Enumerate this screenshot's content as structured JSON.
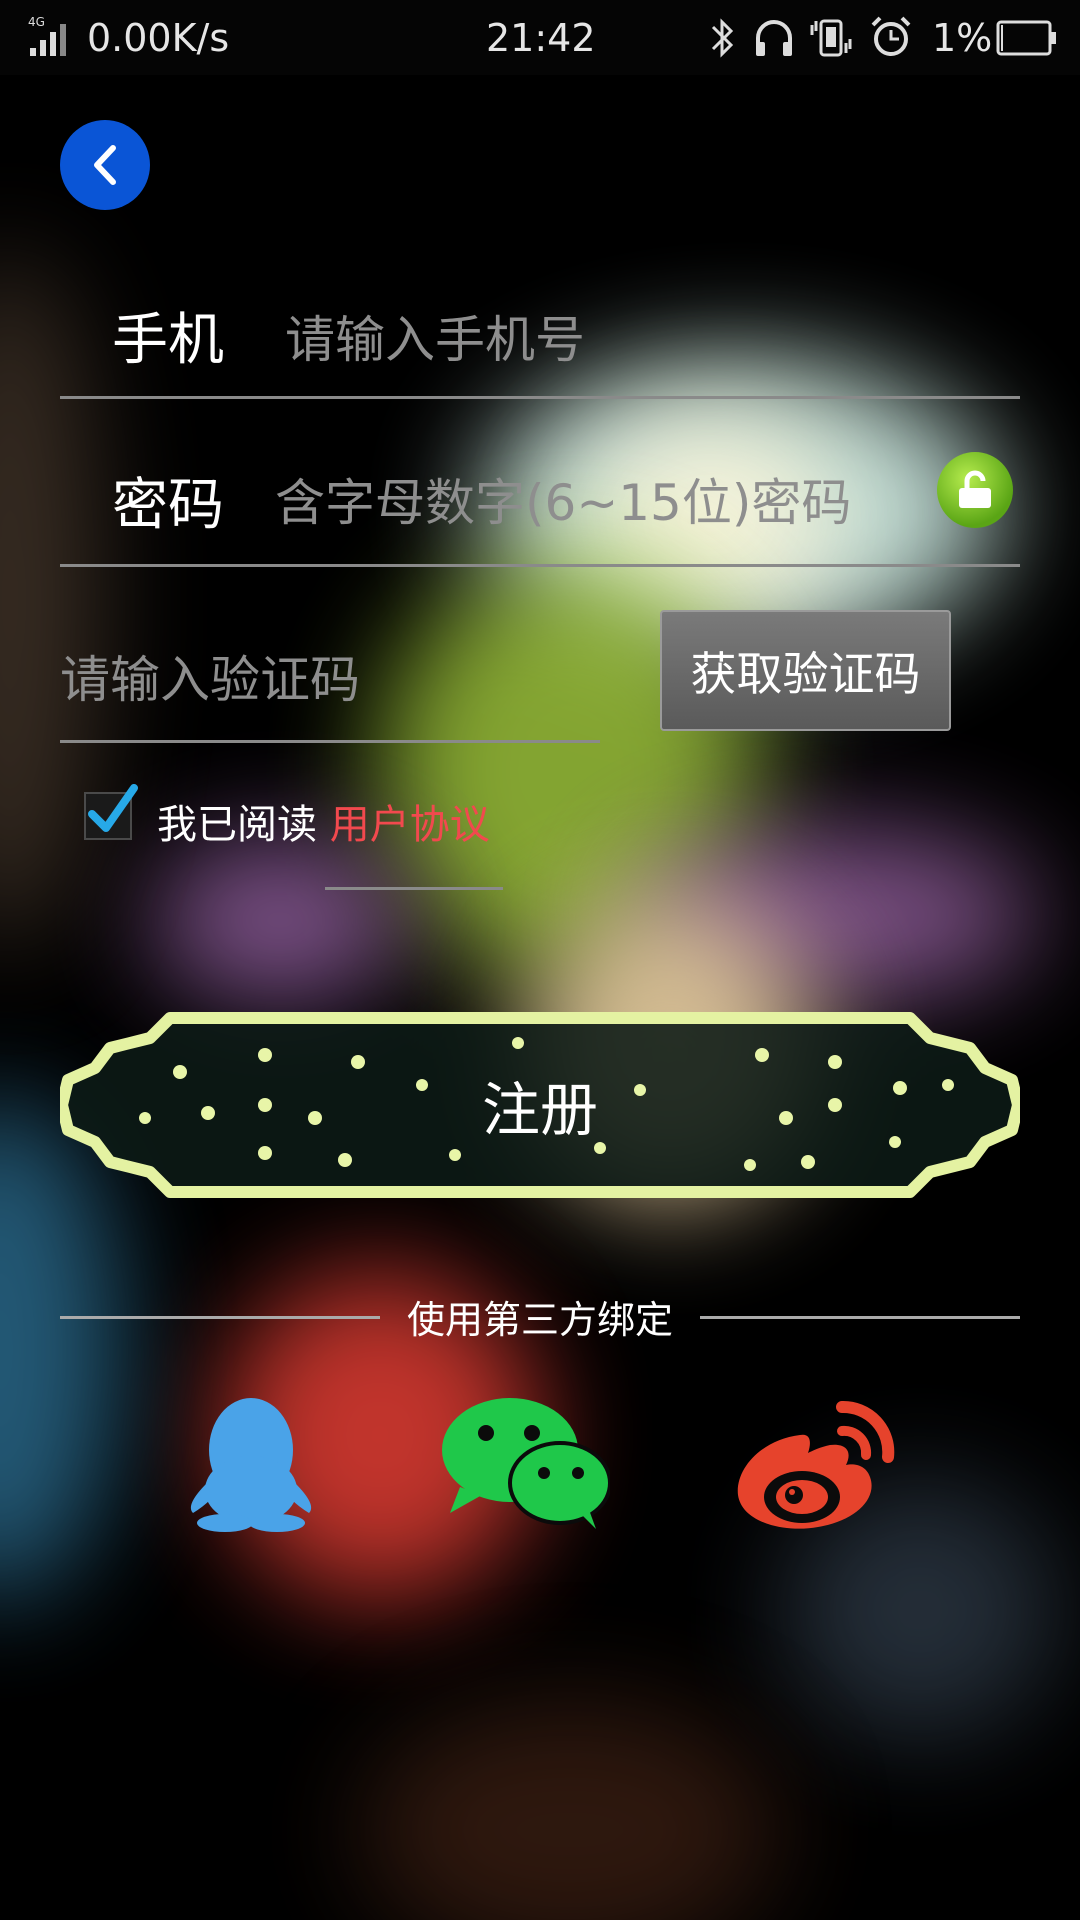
{
  "status_bar": {
    "network": "4G",
    "speed": "0.00K/s",
    "time": "21:42",
    "battery": "1%",
    "icons": [
      "signal-icon",
      "bluetooth-icon",
      "headphone-icon",
      "vibrate-icon",
      "alarm-icon",
      "battery-icon"
    ]
  },
  "back_icon": "chevron-left-icon",
  "phone": {
    "label": "手机",
    "placeholder": "请输入手机号"
  },
  "password": {
    "label": "密码",
    "placeholder": "含字母数字(6~15位)密码"
  },
  "verify": {
    "placeholder": "请输入验证码",
    "button": "获取验证码"
  },
  "agreement": {
    "checked": true,
    "text": "我已阅读",
    "link": "用户协议"
  },
  "register_button": "注册",
  "third_party": {
    "title": "使用第三方绑定",
    "options": [
      "qq-icon",
      "wechat-icon",
      "weibo-icon"
    ]
  },
  "colors": {
    "back_button": "#0a55d6",
    "lock_green": "#6cbd1e",
    "link_red": "#f2494e",
    "qq_blue": "#4aa3e8",
    "wechat_green": "#1fc84a",
    "weibo_red": "#e6432c",
    "register_border": "#e4f2a2"
  }
}
